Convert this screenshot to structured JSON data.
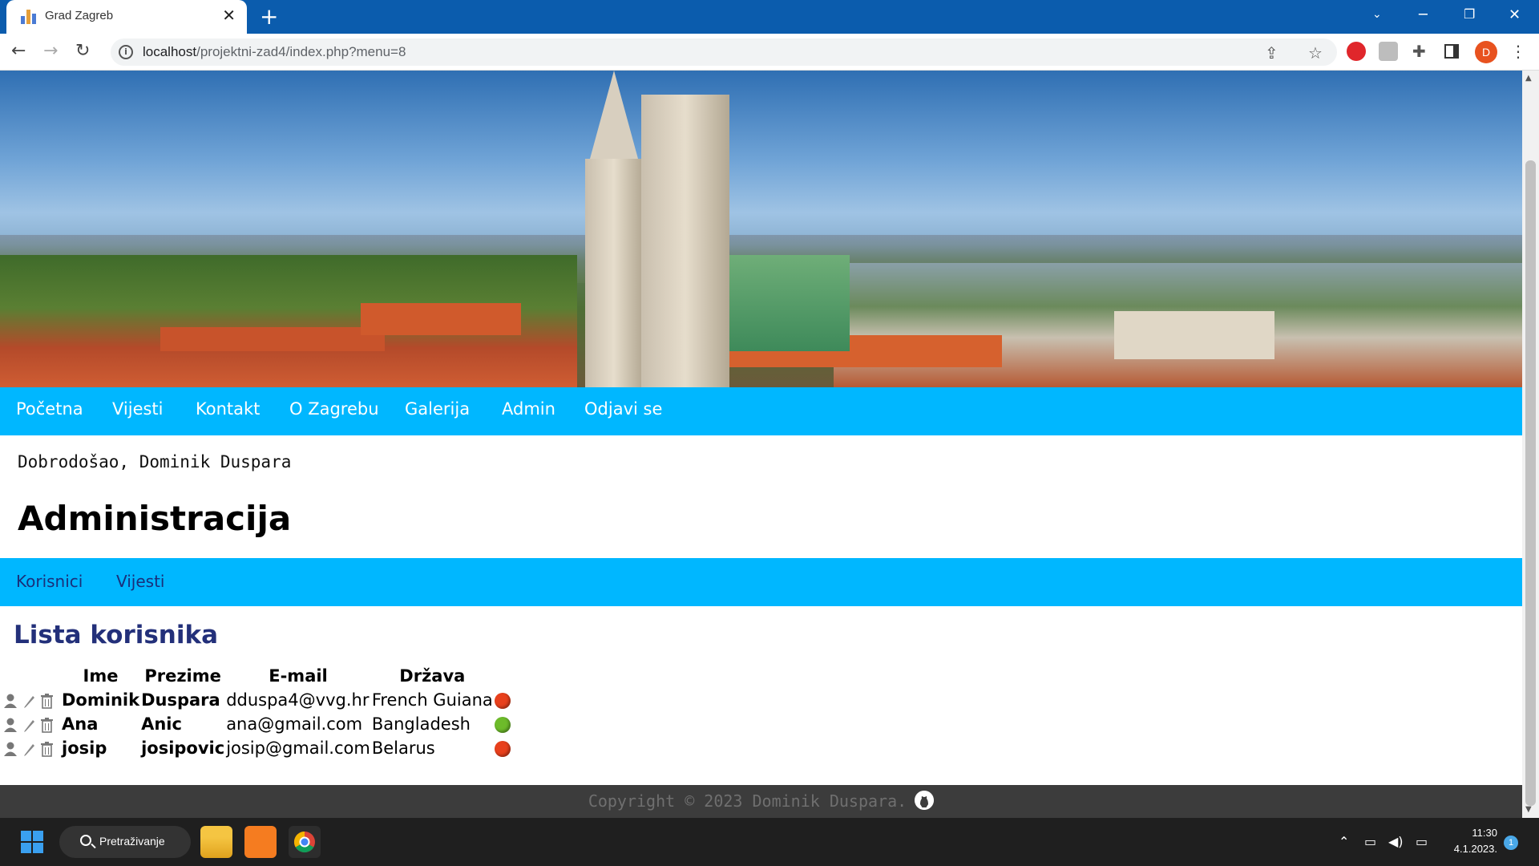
{
  "browser": {
    "tab_title": "Grad Zagreb",
    "close_symbol": "✕",
    "new_tab_symbol": "+",
    "url_host": "localhost",
    "url_path": "/projektni-zad4/index.php?menu=8",
    "profile_initial": "D"
  },
  "nav": {
    "items": [
      "Početna",
      "Vijesti",
      "Kontakt",
      "O Zagrebu",
      "Galerija",
      "Admin",
      "Odjavi se"
    ]
  },
  "welcome": "Dobrodošao, Dominik Duspara",
  "page_title": "Administracija",
  "subnav": {
    "items": [
      "Korisnici",
      "Vijesti"
    ]
  },
  "list_title": "Lista korisnika",
  "table": {
    "headers": {
      "ime": "Ime",
      "prezime": "Prezime",
      "email": "E-mail",
      "drzava": "Država"
    },
    "rows": [
      {
        "ime": "Dominik",
        "prezime": "Duspara",
        "email": "dduspa4@vvg.hr",
        "drzava": "French Guiana",
        "status_color": "#e8401c"
      },
      {
        "ime": "Ana",
        "prezime": "Anic",
        "email": "ana@gmail.com",
        "drzava": "Bangladesh",
        "status_color": "#6dbb2a"
      },
      {
        "ime": "josip",
        "prezime": "josipovic",
        "email": "josip@gmail.com",
        "drzava": "Belarus",
        "status_color": "#e8401c"
      }
    ]
  },
  "footer": {
    "text": "Copyright © 2023 Dominik Duspara.",
    "icon": "github-icon"
  },
  "taskbar": {
    "search_label": "Pretraživanje",
    "time": "11:30",
    "date": "4.1.2023.",
    "notification_count": "1"
  },
  "colors": {
    "nav_bg": "#00b7ff",
    "title_blue": "#23307a",
    "footer_bg": "#3c3c3c"
  }
}
